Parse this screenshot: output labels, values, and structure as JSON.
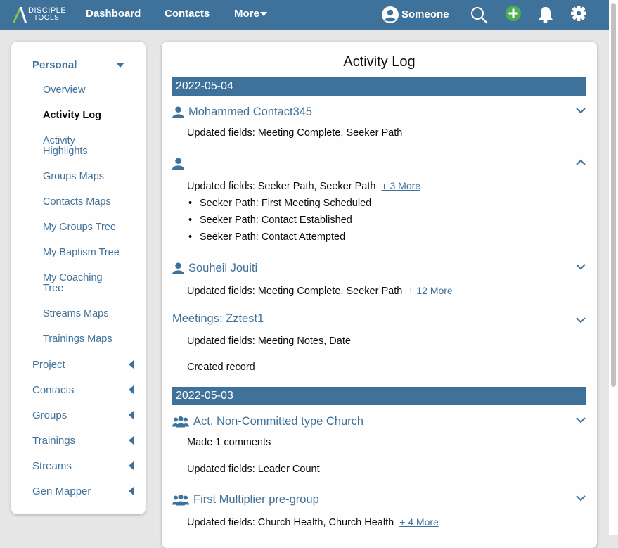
{
  "topbar": {
    "logo_line1": "DISCIPLE",
    "logo_line2": "TOOLS",
    "nav": [
      "Dashboard",
      "Contacts",
      "More"
    ],
    "user_name": "Someone",
    "icons": [
      "search-icon",
      "add-icon",
      "bell-icon",
      "gear-icon"
    ],
    "add_color": "#4caf50"
  },
  "sidebar": {
    "section_title": "Personal",
    "sub_items": [
      "Overview",
      "Activity Log",
      "Activity Highlights",
      "Groups Maps",
      "Contacts Maps",
      "My Groups Tree",
      "My Baptism Tree",
      "My Coaching Tree",
      "Streams Maps",
      "Trainings Maps"
    ],
    "active_item": "Activity Log",
    "sections": [
      "Project",
      "Contacts",
      "Groups",
      "Trainings",
      "Streams",
      "Gen Mapper"
    ]
  },
  "main": {
    "title": "Activity Log",
    "days": [
      {
        "date": "2022-05-04",
        "entries": [
          {
            "title": "Mohammed Contact345",
            "icon": "person-icon",
            "lines": [
              "Updated fields: Meeting Complete, Seeker Path"
            ]
          },
          {
            "title": "",
            "icon": "person-icon",
            "expanded": true,
            "lines": [
              "Updated fields: Seeker Path, Seeker Path"
            ],
            "more": "+ 3 More",
            "bullets": [
              "Seeker Path: First Meeting Scheduled",
              "Seeker Path: Contact Established",
              "Seeker Path: Contact Attempted"
            ]
          },
          {
            "title": "Souheil Jouiti",
            "icon": "person-icon",
            "lines": [
              "Updated fields: Meeting Complete, Seeker Path"
            ],
            "more": "+ 12 More"
          },
          {
            "title": "Meetings: Zztest1",
            "icon": "",
            "lines": [
              "Updated fields: Meeting Notes, Date",
              "Created record"
            ]
          }
        ]
      },
      {
        "date": "2022-05-03",
        "entries": [
          {
            "title": "Act. Non-Committed type Church",
            "icon": "group-icon",
            "lines": [
              "Made 1 comments",
              "Updated fields: Leader Count"
            ]
          },
          {
            "title": "First Multiplier pre-group",
            "icon": "group-icon",
            "lines": [
              "Updated fields: Church Health, Church Health"
            ],
            "more": "+ 4 More"
          }
        ]
      }
    ]
  },
  "colors": {
    "brand": "#3f729b",
    "background": "#e6e6e6"
  }
}
